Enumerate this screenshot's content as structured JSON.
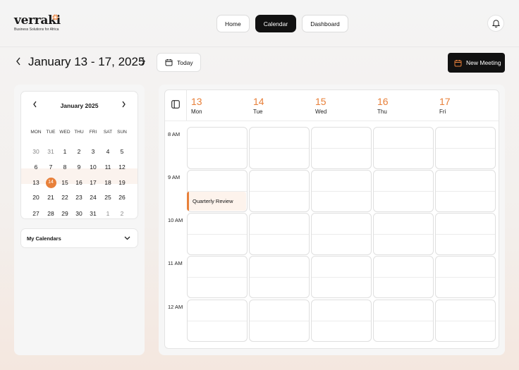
{
  "brand": {
    "name": "verraki",
    "tagline": "Business Solutions for Africa",
    "accent": "#e8803a"
  },
  "nav": {
    "items": [
      "Home",
      "Calendar",
      "Dashboard"
    ],
    "active": "Calendar"
  },
  "toolbar": {
    "range": "January 13 - 17, 2025",
    "today_label": "Today",
    "new_meeting_label": "New Meeting"
  },
  "mini_calendar": {
    "month": "January 2025",
    "weekdays": [
      "MON",
      "TUE",
      "WED",
      "THU",
      "FRI",
      "SAT",
      "SUN"
    ],
    "weeks": [
      [
        "30",
        "31",
        "1",
        "2",
        "3",
        "4",
        "5"
      ],
      [
        "6",
        "7",
        "8",
        "9",
        "10",
        "11",
        "12"
      ],
      [
        "13",
        "14",
        "15",
        "16",
        "17",
        "18",
        "19"
      ],
      [
        "20",
        "21",
        "22",
        "23",
        "24",
        "25",
        "26"
      ],
      [
        "27",
        "28",
        "29",
        "30",
        "31",
        "1",
        "2"
      ]
    ],
    "today": "14"
  },
  "my_calendars": {
    "label": "My Calendars"
  },
  "week": {
    "days": [
      {
        "num": "13",
        "name": "Mon"
      },
      {
        "num": "14",
        "name": "Tue"
      },
      {
        "num": "15",
        "name": "Wed"
      },
      {
        "num": "16",
        "name": "Thu"
      },
      {
        "num": "17",
        "name": "Fri"
      }
    ],
    "hours": [
      "8 AM",
      "9 AM",
      "10 AM",
      "11 AM",
      "12 AM"
    ]
  },
  "events": [
    {
      "title": "Quarterly Review",
      "day": "Mon",
      "start": "9:30 AM"
    }
  ],
  "icons": {
    "bell": "bell-icon",
    "calendar": "calendar-icon",
    "sidebar": "sidebar-toggle-icon",
    "prev": "chevron-left-icon",
    "next": "chevron-right-icon",
    "expand": "chevron-down-icon"
  }
}
